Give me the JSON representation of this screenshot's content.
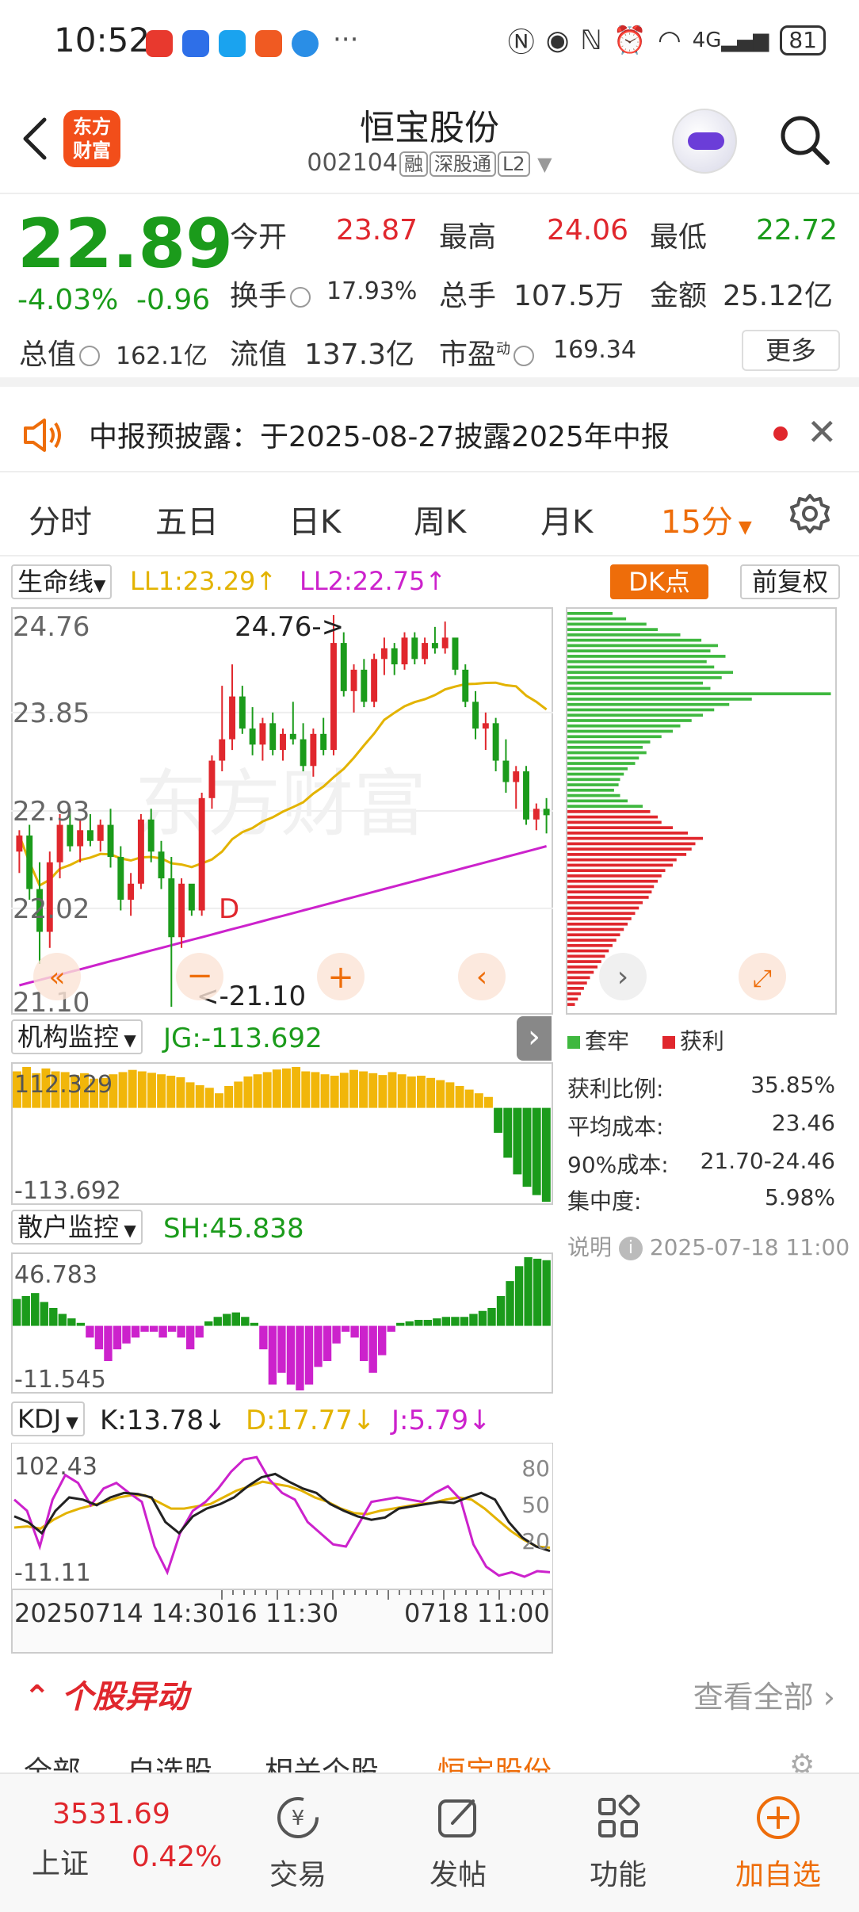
{
  "status_bar": {
    "time": "10:52",
    "battery": "81",
    "network": "4G"
  },
  "header": {
    "logo_line1": "东方",
    "logo_line2": "财富",
    "stock_name": "恒宝股份",
    "stock_code": "002104",
    "tags": [
      "融",
      "深股通",
      "L2"
    ]
  },
  "quote": {
    "price": "22.89",
    "change_pct": "-4.03%",
    "change": "-0.96",
    "open_label": "今开",
    "open": "23.87",
    "high_label": "最高",
    "high": "24.06",
    "low_label": "最低",
    "low": "22.72",
    "turnover_label": "换手",
    "turnover": "17.93%",
    "volume_label": "总手",
    "volume": "107.5万",
    "amount_label": "金额",
    "amount": "25.12亿",
    "mktcap_label": "总值",
    "mktcap": "162.1亿",
    "float_label": "流值",
    "float": "137.3亿",
    "pe_label": "市盈",
    "pe_sup": "动",
    "pe": "169.34",
    "more": "更多"
  },
  "notice": {
    "text": "中报预披露：于2025-08-27披露2025年中报"
  },
  "period_tabs": {
    "items": [
      "分时",
      "五日",
      "日K",
      "周K",
      "月K",
      "15分"
    ],
    "active": "15分"
  },
  "chart_controls": {
    "indicator": "生命线",
    "ll1": "LL1:23.29↑",
    "ll2": "LL2:22.75↑",
    "dk": "DK点",
    "adjust": "前复权"
  },
  "colors": {
    "up": "#e0272d",
    "down": "#1b9b1b",
    "accent": "#ee6d0a",
    "ll1": "#e3b300",
    "ll2": "#cc22cc"
  },
  "chart_data": [
    {
      "type": "candlestick",
      "title": "",
      "y_ticks": [
        "24.76",
        "23.85",
        "22.93",
        "22.02",
        "21.10"
      ],
      "ylim": [
        21.1,
        24.76
      ],
      "max_annotation": "24.76->",
      "min_annotation": "<-21.10",
      "signal_label": "D",
      "watermark": "东方财富",
      "candles": [
        [
          22.55,
          22.75,
          22.35,
          22.7
        ],
        [
          22.7,
          22.8,
          22.1,
          22.2
        ],
        [
          22.2,
          22.45,
          21.5,
          21.8
        ],
        [
          21.8,
          22.55,
          21.65,
          22.45
        ],
        [
          22.45,
          22.9,
          22.3,
          22.8
        ],
        [
          22.8,
          22.95,
          22.55,
          22.6
        ],
        [
          22.6,
          22.85,
          22.45,
          22.75
        ],
        [
          22.75,
          22.9,
          22.6,
          22.65
        ],
        [
          22.65,
          22.85,
          22.55,
          22.8
        ],
        [
          22.8,
          22.95,
          22.4,
          22.5
        ],
        [
          22.5,
          22.6,
          22.0,
          22.1
        ],
        [
          22.1,
          22.35,
          21.95,
          22.25
        ],
        [
          22.25,
          22.9,
          22.2,
          22.85
        ],
        [
          22.85,
          22.95,
          22.45,
          22.55
        ],
        [
          22.55,
          22.65,
          22.2,
          22.3
        ],
        [
          22.3,
          22.5,
          21.1,
          21.75
        ],
        [
          21.75,
          22.3,
          21.65,
          22.25
        ],
        [
          22.25,
          22.1,
          21.95,
          22.0
        ],
        [
          22.0,
          23.1,
          21.95,
          23.05
        ],
        [
          23.05,
          23.45,
          22.95,
          23.4
        ],
        [
          23.4,
          24.1,
          23.3,
          23.6
        ],
        [
          23.6,
          24.3,
          23.5,
          24.0
        ],
        [
          24.0,
          24.1,
          23.65,
          23.7
        ],
        [
          23.7,
          23.9,
          23.45,
          23.55
        ],
        [
          23.55,
          23.8,
          23.4,
          23.75
        ],
        [
          23.75,
          23.85,
          23.45,
          23.5
        ],
        [
          23.5,
          23.7,
          23.4,
          23.65
        ],
        [
          23.65,
          23.95,
          23.55,
          23.6
        ],
        [
          23.6,
          23.75,
          23.3,
          23.35
        ],
        [
          23.35,
          23.7,
          23.25,
          23.65
        ],
        [
          23.65,
          23.8,
          23.45,
          23.5
        ],
        [
          23.5,
          24.76,
          23.45,
          24.5
        ],
        [
          24.5,
          24.6,
          24.0,
          24.05
        ],
        [
          24.05,
          24.3,
          23.85,
          24.25
        ],
        [
          24.25,
          24.35,
          23.9,
          23.95
        ],
        [
          23.95,
          24.4,
          23.9,
          24.35
        ],
        [
          24.35,
          24.55,
          24.2,
          24.45
        ],
        [
          24.45,
          24.5,
          24.2,
          24.3
        ],
        [
          24.3,
          24.6,
          24.25,
          24.55
        ],
        [
          24.55,
          24.6,
          24.3,
          24.35
        ],
        [
          24.35,
          24.55,
          24.3,
          24.5
        ],
        [
          24.5,
          24.65,
          24.4,
          24.45
        ],
        [
          24.45,
          24.7,
          24.4,
          24.55
        ],
        [
          24.55,
          24.5,
          24.2,
          24.25
        ],
        [
          24.25,
          24.3,
          23.9,
          23.95
        ],
        [
          23.95,
          24.05,
          23.6,
          23.7
        ],
        [
          23.7,
          23.85,
          23.5,
          23.75
        ],
        [
          23.75,
          23.8,
          23.3,
          23.4
        ],
        [
          23.4,
          23.6,
          23.1,
          23.2
        ],
        [
          23.2,
          23.35,
          22.95,
          23.3
        ],
        [
          23.3,
          23.35,
          22.8,
          22.85
        ],
        [
          22.85,
          23.0,
          22.75,
          22.95
        ],
        [
          22.95,
          23.05,
          22.72,
          22.89
        ]
      ]
    },
    {
      "type": "bar",
      "title": "筹码分布",
      "legend": [
        "套牢",
        "获利"
      ],
      "profit_ratio_label": "获利比例:",
      "profit_ratio": "35.85%",
      "avg_cost_label": "平均成本:",
      "avg_cost": "23.46",
      "cost90_label": "90%成本:",
      "cost90": "21.70-24.46",
      "concentration_label": "集中度:",
      "concentration": "5.98%",
      "note_label": "说明",
      "note_time": "2025-07-18 11:00",
      "trapped": [
        60,
        78,
        105,
        120,
        150,
        178,
        200,
        190,
        210,
        185,
        195,
        220,
        205,
        180,
        190,
        350,
        245,
        215,
        195,
        180,
        165,
        150,
        140,
        125,
        110,
        100,
        105,
        95,
        90,
        80,
        75,
        70,
        68,
        62,
        70,
        80,
        100
      ],
      "profit": [
        110,
        120,
        125,
        140,
        160,
        180,
        170,
        165,
        158,
        145,
        140,
        130,
        125,
        120,
        115,
        112,
        108,
        100,
        95,
        90,
        85,
        80,
        75,
        70,
        65,
        60,
        55,
        50,
        45,
        40,
        35,
        30,
        26,
        22,
        18,
        14,
        10
      ]
    },
    {
      "type": "bar",
      "title": "机构监控",
      "label": "JG:-113.692",
      "ymax_label": "112.329",
      "ymin_label": "-113.692",
      "values": [
        100,
        112,
        95,
        108,
        100,
        98,
        90,
        95,
        80,
        82,
        92,
        98,
        104,
        100,
        96,
        92,
        88,
        84,
        70,
        62,
        55,
        40,
        60,
        72,
        86,
        92,
        98,
        105,
        108,
        112,
        100,
        98,
        92,
        88,
        96,
        104,
        100,
        95,
        90,
        98,
        92,
        86,
        88,
        82,
        76,
        70,
        60,
        50,
        40,
        30,
        -30,
        -60,
        -80,
        -95,
        -105,
        -113
      ]
    },
    {
      "type": "bar",
      "title": "散户监控",
      "label": "SH:45.838",
      "ymax_label": "46.783",
      "ymin_label": "-11.545",
      "values": [
        18,
        20,
        22,
        16,
        12,
        8,
        5,
        2,
        -2,
        -4,
        -6,
        -4,
        -3,
        -2,
        -1,
        -1,
        -2,
        -1,
        -2,
        -4,
        -2,
        3,
        6,
        8,
        9,
        6,
        2,
        -4,
        -10,
        -8,
        -10,
        -11,
        -10,
        -7,
        -6,
        -3,
        -1,
        -2,
        -6,
        -8,
        -5,
        -1,
        2,
        3,
        4,
        4,
        5,
        6,
        6,
        6,
        8,
        10,
        12,
        20,
        30,
        40,
        46,
        45,
        44
      ]
    },
    {
      "type": "line",
      "title": "KDJ",
      "series_labels": [
        "K:13.78↓",
        "D:17.77↓",
        "J:5.79↓"
      ],
      "ymax_label": "102.43",
      "ymin_label": "-11.11",
      "right_ticks": [
        "80",
        "50",
        "20"
      ],
      "x_labels": [
        "20250714 14:30",
        "16 11:30",
        "0718 11:00"
      ],
      "K": [
        45,
        40,
        30,
        50,
        62,
        60,
        55,
        62,
        66,
        65,
        62,
        40,
        30,
        45,
        52,
        56,
        62,
        72,
        80,
        83,
        76,
        70,
        66,
        56,
        50,
        45,
        42,
        44,
        52,
        54,
        56,
        58,
        57,
        62,
        66,
        60,
        40,
        26,
        18,
        14
      ],
      "D": [
        35,
        36,
        34,
        42,
        48,
        52,
        55,
        58,
        62,
        64,
        64,
        58,
        52,
        52,
        54,
        56,
        62,
        68,
        72,
        76,
        74,
        72,
        68,
        62,
        58,
        52,
        48,
        47,
        50,
        52,
        54,
        56,
        57,
        60,
        62,
        60,
        52,
        42,
        32,
        24,
        18,
        17
      ],
      "J": [
        60,
        50,
        18,
        60,
        82,
        75,
        55,
        70,
        75,
        66,
        58,
        18,
        -5,
        30,
        50,
        58,
        70,
        85,
        96,
        98,
        78,
        66,
        60,
        40,
        30,
        20,
        18,
        38,
        58,
        60,
        62,
        60,
        58,
        66,
        72,
        60,
        20,
        0,
        -8,
        -5,
        -9,
        -4,
        -5
      ]
    }
  ],
  "movers": {
    "title": "个股异动",
    "see_all": "查看全部",
    "subtabs": [
      "全部",
      "自选股",
      "相关个股",
      "恒宝股份"
    ]
  },
  "bottom_bar": {
    "index_value": "3531.69",
    "index_name": "上证",
    "index_pct": "0.42%",
    "items": [
      "交易",
      "发帖",
      "功能",
      "加自选"
    ]
  }
}
